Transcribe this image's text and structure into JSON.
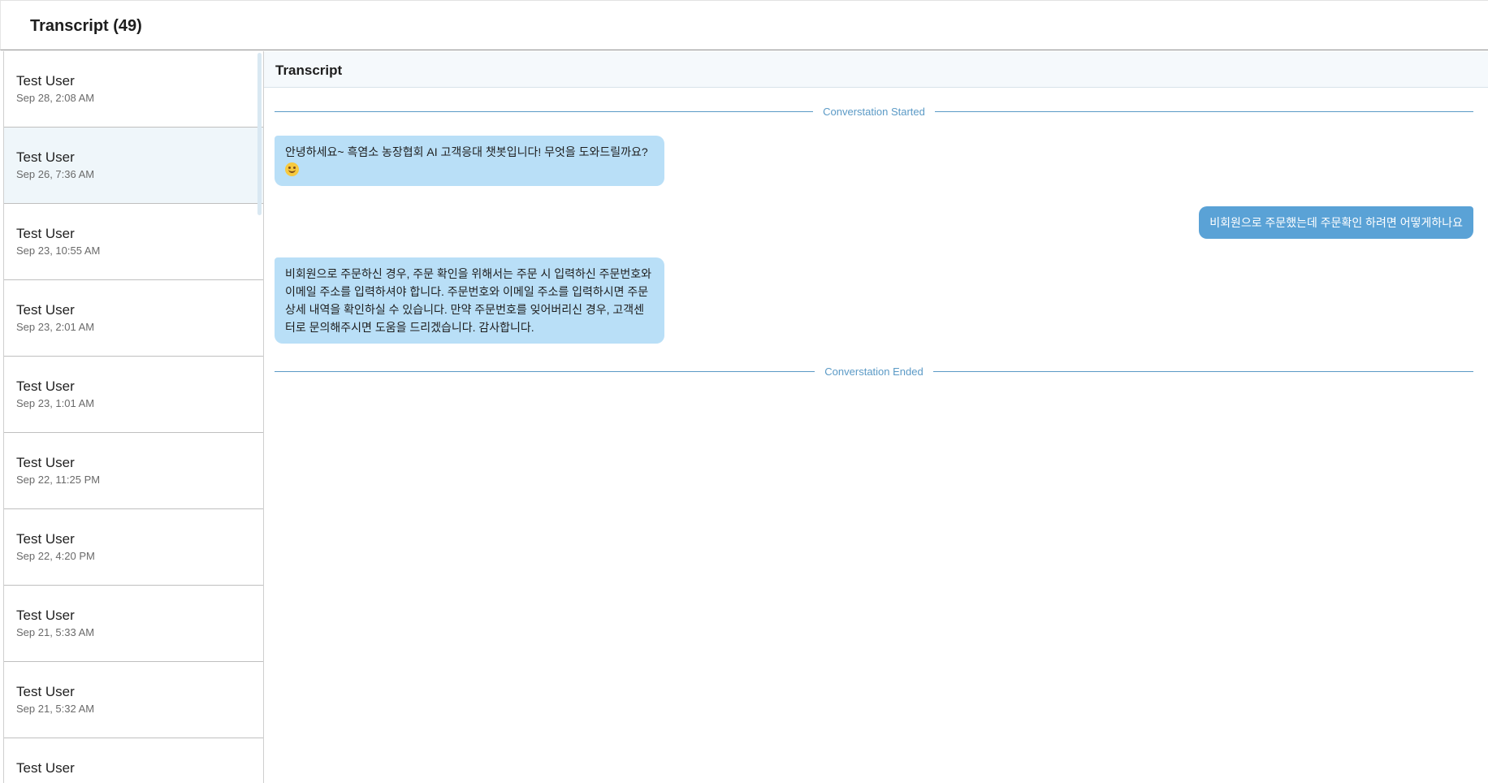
{
  "header": {
    "title": "Transcript (49)"
  },
  "sidebar": {
    "items": [
      {
        "name": "Test User",
        "time": "Sep 28, 2:08 AM"
      },
      {
        "name": "Test User",
        "time": "Sep 26, 7:36 AM"
      },
      {
        "name": "Test User",
        "time": "Sep 23, 10:55 AM"
      },
      {
        "name": "Test User",
        "time": "Sep 23, 2:01 AM"
      },
      {
        "name": "Test User",
        "time": "Sep 23, 1:01 AM"
      },
      {
        "name": "Test User",
        "time": "Sep 22, 11:25 PM"
      },
      {
        "name": "Test User",
        "time": "Sep 22, 4:20 PM"
      },
      {
        "name": "Test User",
        "time": "Sep 21, 5:33 AM"
      },
      {
        "name": "Test User",
        "time": "Sep 21, 5:32 AM"
      },
      {
        "name": "Test User",
        "time": ""
      }
    ]
  },
  "main": {
    "title": "Transcript",
    "started_label": "Converstation Started",
    "ended_label": "Converstation Ended",
    "messages": [
      {
        "role": "bot",
        "text": "안녕하세요~ 흑염소 농장협회 AI 고객응대 챗봇입니다! 무엇을 도와드릴까요?",
        "emoji": "smiling-face-icon"
      },
      {
        "role": "user",
        "text": "비회원으로 주문했는데 주문확인 하려면 어떻게하나요"
      },
      {
        "role": "bot",
        "text": "비회원으로 주문하신 경우, 주문 확인을 위해서는 주문 시 입력하신 주문번호와 이메일 주소를 입력하셔야 합니다. 주문번호와 이메일 주소를 입력하시면 주문 상세 내역을 확인하실 수 있습니다. 만약 주문번호를 잊어버리신 경우, 고객센터로 문의해주시면 도움을 드리겠습니다. 감사합니다."
      }
    ]
  }
}
